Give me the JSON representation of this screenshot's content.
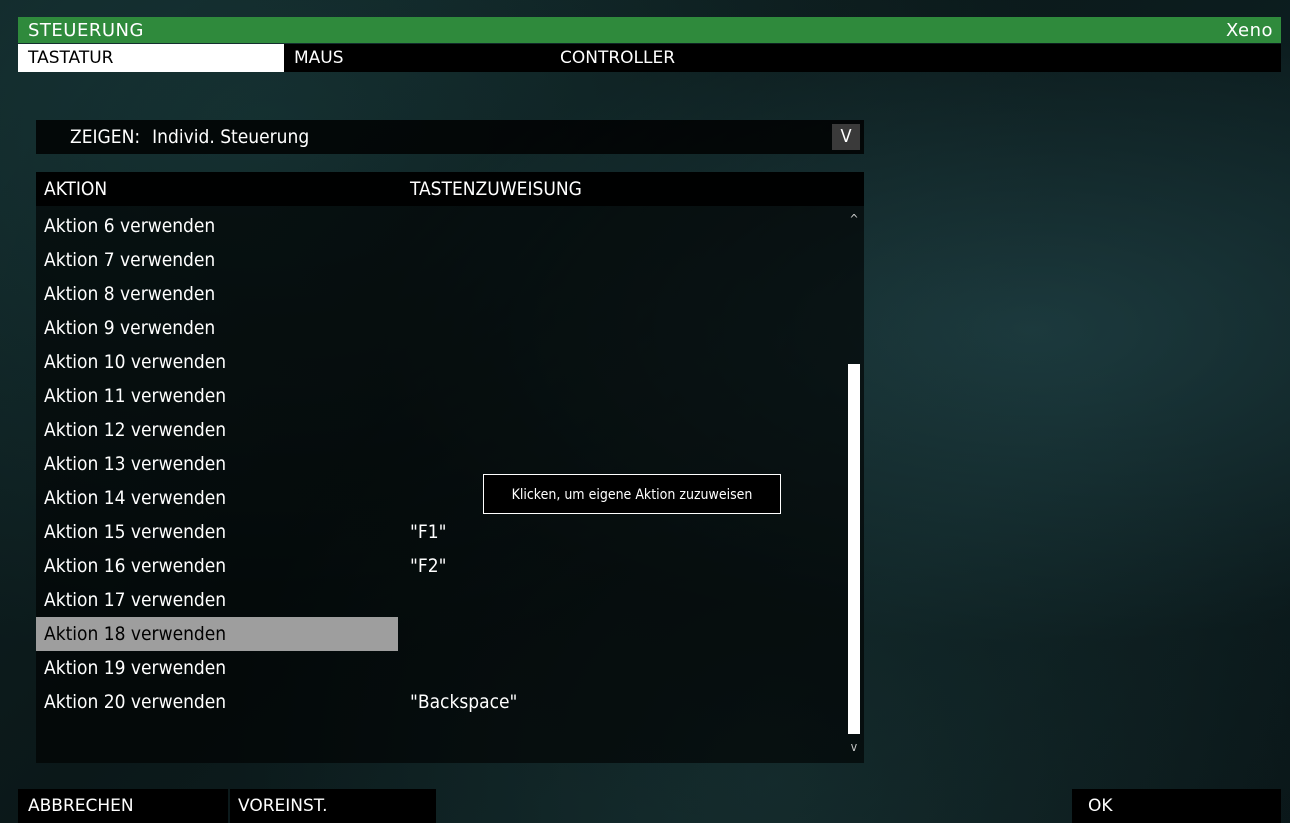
{
  "window": {
    "title": "STEUERUNG",
    "user": "Xeno"
  },
  "tabs": [
    {
      "label": "TASTATUR",
      "active": true
    },
    {
      "label": "MAUS",
      "active": false
    },
    {
      "label": "CONTROLLER",
      "active": false
    }
  ],
  "filter": {
    "label": "ZEIGEN:",
    "value": "Individ. Steuerung",
    "dropdown_glyph": "V"
  },
  "table": {
    "headers": {
      "action": "AKTION",
      "binding": "TASTENZUWEISUNG"
    },
    "rows": [
      {
        "action": "Aktion 6 verwenden",
        "key": ""
      },
      {
        "action": "Aktion 7 verwenden",
        "key": ""
      },
      {
        "action": "Aktion 8 verwenden",
        "key": ""
      },
      {
        "action": "Aktion 9 verwenden",
        "key": ""
      },
      {
        "action": "Aktion 10 verwenden",
        "key": ""
      },
      {
        "action": "Aktion 11 verwenden",
        "key": ""
      },
      {
        "action": "Aktion 12 verwenden",
        "key": ""
      },
      {
        "action": "Aktion 13 verwenden",
        "key": ""
      },
      {
        "action": "Aktion 14 verwenden",
        "key": ""
      },
      {
        "action": "Aktion 15 verwenden",
        "key": "\"F1\""
      },
      {
        "action": "Aktion 16 verwenden",
        "key": "\"F2\""
      },
      {
        "action": "Aktion 17 verwenden",
        "key": ""
      },
      {
        "action": "Aktion 18 verwenden",
        "key": "",
        "selected": true
      },
      {
        "action": "Aktion 19 verwenden",
        "key": ""
      },
      {
        "action": "Aktion 20 verwenden",
        "key": "\"Backspace\""
      }
    ],
    "scroll": {
      "up_glyph": "^",
      "down_glyph": "v"
    }
  },
  "tooltip": {
    "text": "Klicken, um eigene Aktion zuzuweisen"
  },
  "footer": {
    "cancel": "ABBRECHEN",
    "defaults": "VOREINST.",
    "ok": "OK"
  },
  "colors": {
    "titlebar": "#2f8a3c",
    "selected_row": "#9e9e9e",
    "panel": "#000000"
  }
}
